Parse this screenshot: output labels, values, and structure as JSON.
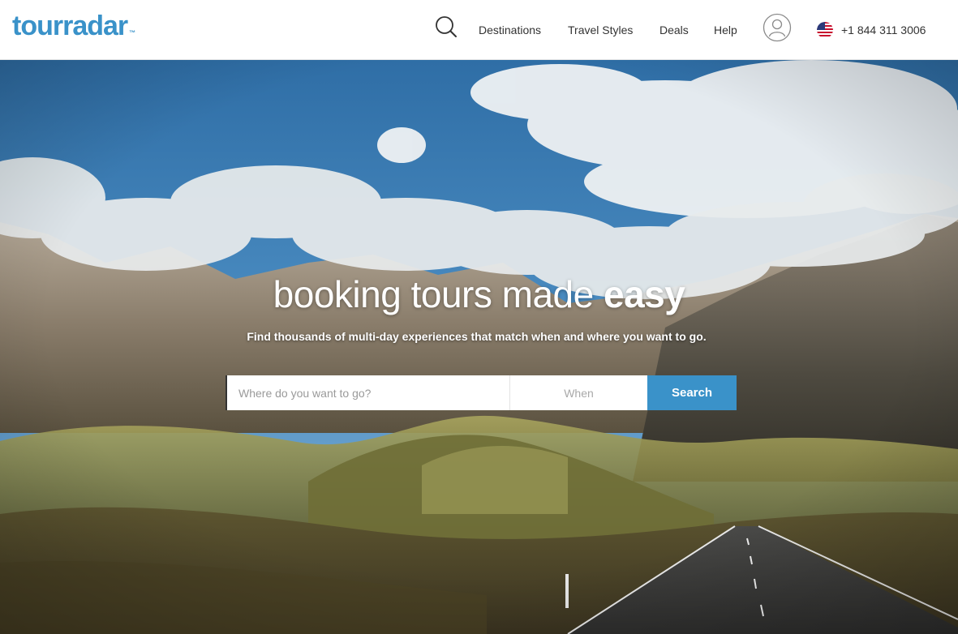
{
  "header": {
    "logo_text": "tourradar",
    "logo_tm": "™",
    "nav": {
      "destinations": "Destinations",
      "travel_styles": "Travel Styles",
      "deals": "Deals",
      "help": "Help"
    },
    "phone": "+1 844 311 3006",
    "icons": [
      "search-icon",
      "user-account-icon",
      "us-flag-icon"
    ]
  },
  "hero": {
    "headline_regular": "booking tours made ",
    "headline_bold": "easy",
    "subline": "Find thousands of multi-day experiences that match when and where you want to go.",
    "search": {
      "where_placeholder": "Where do you want to go?",
      "when_placeholder": "When",
      "button_label": "Search"
    }
  },
  "colors": {
    "brand_blue": "#3a92c9",
    "text_dark": "#333333",
    "header_bg": "#ffffff"
  }
}
